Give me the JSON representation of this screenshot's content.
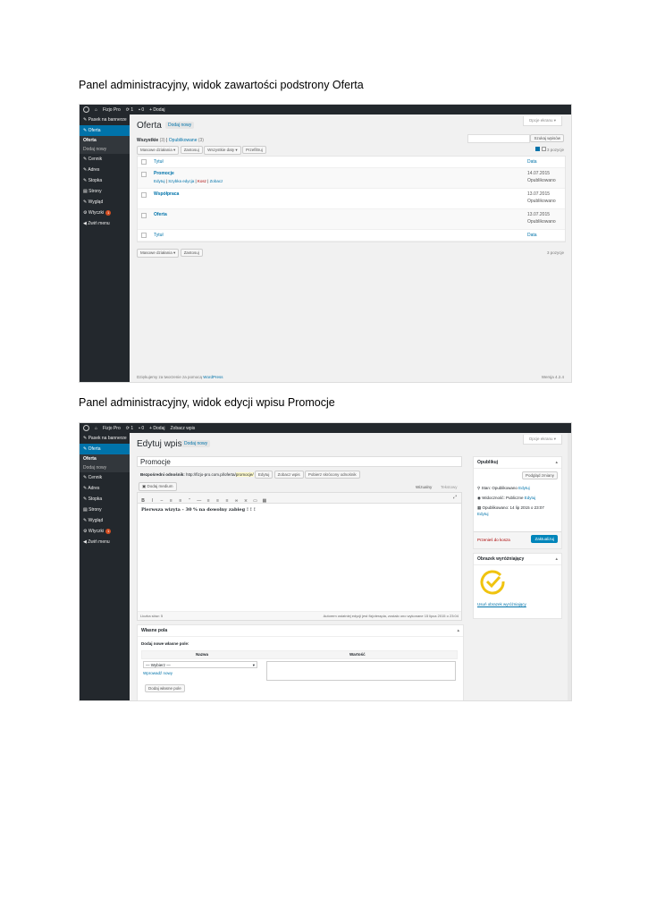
{
  "captions": {
    "first": "Panel administracyjny, widok zawartości podstrony Oferta",
    "second": "Panel administracyjny, widok edycji wpisu Promocje"
  },
  "shot1": {
    "adminbar": {
      "site": "Fizjo Pro",
      "updates": "1",
      "comments": "0",
      "new": "Dodaj"
    },
    "sidebar": {
      "items": [
        "Pasek na bannerze",
        "Oferta",
        "Cennik",
        "Adres",
        "Stopka",
        "Strony",
        "Wygląd",
        "Wtyczki",
        "Zwiń menu"
      ],
      "sub": [
        "Oferta",
        "Dodaj nowy"
      ],
      "plugins_badge": "1"
    },
    "screen_options": "Opcje ekranu ▾",
    "title": "Oferta",
    "add_new": "Dodaj nowy",
    "filters": {
      "all": "Wszystkie",
      "all_count": "(3)",
      "published": "Opublikowane",
      "published_count": "(3)"
    },
    "search_button": "Szukaj wpisów",
    "bulk": {
      "label": "Masowe działania",
      "apply": "Zastosuj",
      "dates": "Wszystkie daty",
      "filter": "Przefiltruj"
    },
    "items_count": "3 pozycje",
    "columns": {
      "title": "Tytuł",
      "date": "Data"
    },
    "rows": [
      {
        "title": "Promocje",
        "actions": [
          "Edytuj",
          "Szybka edycja",
          "Kosz",
          "Zobacz"
        ],
        "date": "14.07.2015",
        "status": "Opublikowano"
      },
      {
        "title": "Współpraca",
        "date": "13.07.2015",
        "status": "Opublikowano"
      },
      {
        "title": "Oferta",
        "date": "13.07.2015",
        "status": "Opublikowano"
      }
    ],
    "footer": {
      "thanks": "Dziękujemy za tworzenie za pomocą",
      "wp": "WordPress",
      "version": "Wersja 4.2.4"
    }
  },
  "shot2": {
    "adminbar": {
      "site": "Fizjo Pro",
      "updates": "1",
      "comments": "0",
      "new": "Dodaj",
      "view": "Zobacz wpis"
    },
    "screen_options": "Opcje ekranu ▾",
    "title": "Edytuj wpis",
    "add_new": "Dodaj nowy",
    "post_title": "Promocje",
    "permalink": {
      "label": "Bezpośredni odnośnik:",
      "url": "http://fizjo-pro.com.pl/oferta/",
      "slug": "promocje/",
      "edit": "Edytuj",
      "view": "Zobacz wpis",
      "shortlink": "Pobierz skrócony odnośnik"
    },
    "add_media": "Dodaj medium",
    "tabs": {
      "visual": "Wizualny",
      "text": "Tekstowy"
    },
    "body_text": "Pierwsza wizyta - 30 % na dowolny zabieg ! ! !",
    "word_count": "Liczba słów: 5",
    "last_edit": "Autorem ostatniej edycji jest fizjoterapia, zostało ono wykonane 15 lipca 2015 o 23:04",
    "publish": {
      "title": "Opublikuj",
      "preview": "Podgląd zmiany",
      "status": "Stan: Opublikowano",
      "status_edit": "Edytuj",
      "visibility": "Widoczność: Publiczne",
      "visibility_edit": "Edytuj",
      "published_on": "Opublikowano: 14 lip 2015 o 23:07",
      "published_edit": "Edytuj",
      "trash": "Przenieś do kosza",
      "update": "Zaktualizuj"
    },
    "featured": {
      "title": "Obrazek wyróżniający",
      "remove": "Usuń obrazek wyróżniający"
    },
    "custom_fields": {
      "title": "Własne pola",
      "add_new": "Dodaj nowe własne pole:",
      "name": "Nazwa",
      "value": "Wartość",
      "select": "— Wybierz —",
      "enter_new": "Wprowadź nowy",
      "add_button": "Dodaj własne pole"
    }
  }
}
